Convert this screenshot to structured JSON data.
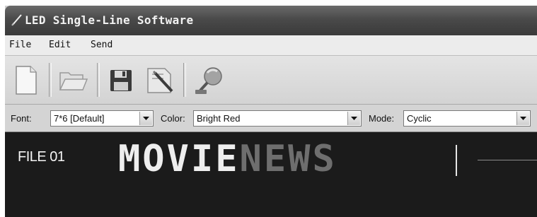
{
  "window": {
    "title": "LED Single-Line Software",
    "title_icon": "pencil-icon"
  },
  "menu": [
    "File",
    "Edit",
    "Send"
  ],
  "toolbar": {
    "buttons": [
      "new-file-icon",
      "open-folder-icon",
      "save-disk-icon",
      "edit-document-icon",
      "send-satellite-icon"
    ]
  },
  "options": {
    "font_label": "Font:",
    "font_value": "7*6 [Default]",
    "color_label": "Color:",
    "color_value": "Bright Red",
    "mode_label": "Mode:",
    "mode_value": "Cyclic"
  },
  "display": {
    "file_label": "FILE 01",
    "text_part1": "MOVIE",
    "text_part2": "NEWS"
  },
  "colors": {
    "titlebar": "#4a4a4a",
    "display_bg": "#1b1b1b",
    "led_bright": "#eeeeee",
    "led_dim": "#6e6e6e"
  }
}
